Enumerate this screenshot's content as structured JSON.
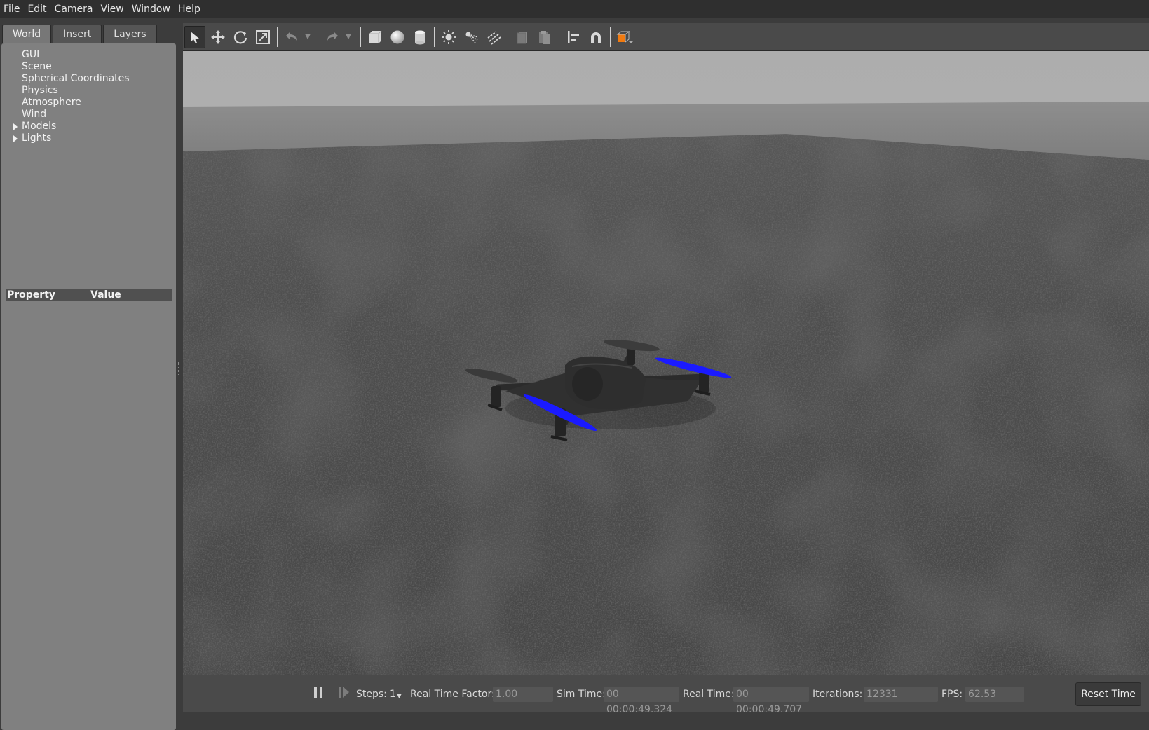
{
  "menu": [
    "File",
    "Edit",
    "Camera",
    "View",
    "Window",
    "Help"
  ],
  "tabs": [
    "World",
    "Insert",
    "Layers"
  ],
  "tree": [
    {
      "label": "GUI",
      "expandable": false
    },
    {
      "label": "Scene",
      "expandable": false
    },
    {
      "label": "Spherical Coordinates",
      "expandable": false
    },
    {
      "label": "Physics",
      "expandable": false
    },
    {
      "label": "Atmosphere",
      "expandable": false
    },
    {
      "label": "Wind",
      "expandable": false
    },
    {
      "label": "Models",
      "expandable": true
    },
    {
      "label": "Lights",
      "expandable": true
    }
  ],
  "properties": {
    "col_property": "Property",
    "col_value": "Value"
  },
  "toolbar": {
    "icons": [
      "select-arrow-icon",
      "translate-icon",
      "rotate-icon",
      "scale-icon",
      "undo-icon",
      "redo-icon",
      "box-icon",
      "sphere-icon",
      "cylinder-icon",
      "point-light-icon",
      "spot-light-icon",
      "directional-light-icon",
      "copy-icon",
      "paste-icon",
      "align-icon",
      "snap-icon",
      "view-angle-icon"
    ]
  },
  "status": {
    "steps_label": "Steps:",
    "steps_value": "1",
    "rtf_label": "Real Time Factor:",
    "rtf_value": "1.00",
    "sim_time_label": "Sim Time:",
    "sim_time_value": "00 00:00:49.324",
    "real_time_label": "Real Time:",
    "real_time_value": "00 00:00:49.707",
    "iterations_label": "Iterations:",
    "iterations_value": "12331",
    "fps_label": "FPS:",
    "fps_value": "62.53",
    "reset_label": "Reset Time"
  },
  "colors": {
    "propeller": "#1a1aff",
    "ground": "#4a4a4a",
    "sky": "#b0b0b0",
    "view_angle_orange": "#f07a10"
  }
}
